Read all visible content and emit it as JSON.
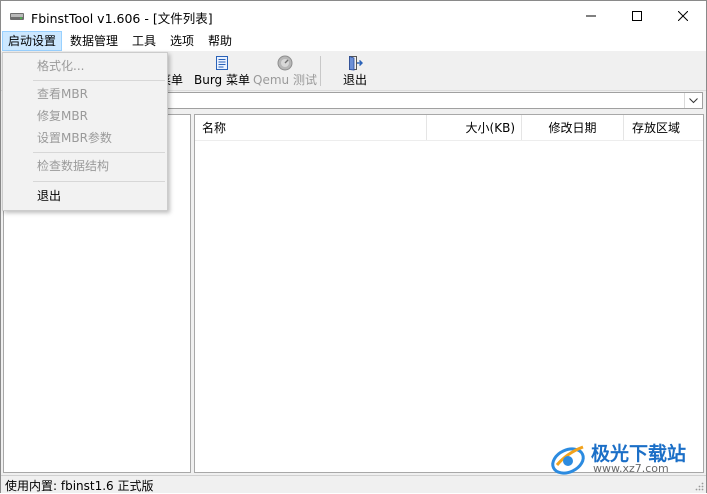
{
  "window": {
    "title": "FbinstTool v1.606 - [文件列表]"
  },
  "menubar": {
    "items": [
      "启动设置",
      "数据管理",
      "工具",
      "选项",
      "帮助"
    ]
  },
  "toolbar": {
    "partial_label": "菜单",
    "burg_label": "Burg 菜单",
    "qemu_label": "Qemu 测试",
    "exit_label": "退出"
  },
  "file_list": {
    "columns": [
      "名称",
      "大小(KB)",
      "修改日期",
      "存放区域"
    ]
  },
  "status": {
    "text": "使用内置: fbinst1.6 正式版"
  },
  "dropdown": {
    "items": [
      {
        "label": "格式化...",
        "enabled": false
      },
      {
        "label": "查看MBR",
        "enabled": false
      },
      {
        "label": "修复MBR",
        "enabled": false
      },
      {
        "label": "设置MBR参数",
        "enabled": false
      },
      {
        "label": "检查数据结构",
        "enabled": false
      },
      {
        "label": "退出",
        "enabled": true
      }
    ]
  },
  "watermark": {
    "brand": "极光下载站",
    "url": "www.xz7.com"
  },
  "colors": {
    "menu_highlight": "#cce8ff",
    "watermark_blue": "#1b6fc7"
  }
}
